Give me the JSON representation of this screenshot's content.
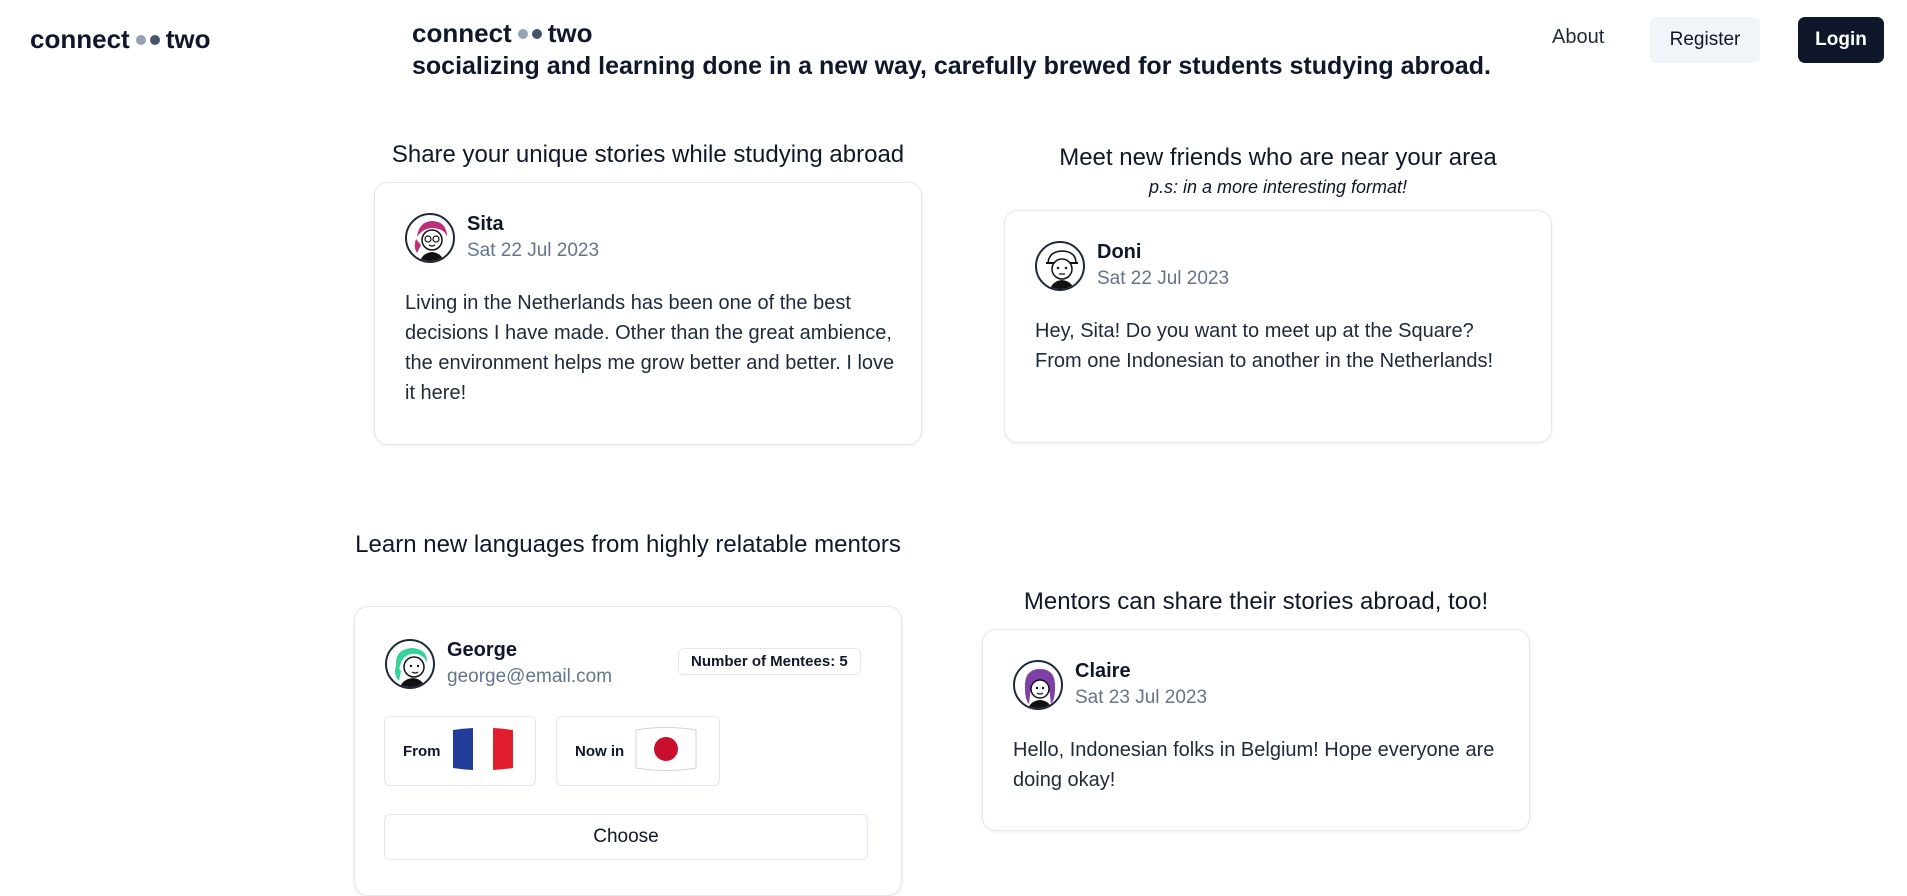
{
  "brand": {
    "word1": "connect",
    "word2": "two",
    "dot1_color": "#94a3b8",
    "dot2_color": "#475569"
  },
  "nav": {
    "about": "About",
    "register": "Register",
    "login": "Login"
  },
  "hero": {
    "tagline": "socializing and learning done in a new way, carefully brewed for students studying abroad."
  },
  "sections": {
    "stories": {
      "title": "Share your unique stories while studying abroad",
      "post": {
        "name": "Sita",
        "date": "Sat 22 Jul 2023",
        "body": "Living in the Netherlands has been one of the best decisions I have made. Other than the great ambience, the environment helps me grow better and better. I love it here!"
      }
    },
    "friends": {
      "title": "Meet new friends who are near your area",
      "subtitle": "p.s: in a more interesting format!",
      "post": {
        "name": "Doni",
        "date": "Sat 22 Jul 2023",
        "body": "Hey, Sita! Do you want to meet up at the Square? From one Indonesian to another in the Netherlands!"
      }
    },
    "languages": {
      "title": "Learn new languages from highly relatable mentors",
      "mentor": {
        "name": "George",
        "email": "george@email.com",
        "mentees_badge": "Number of Mentees: 5",
        "from_label": "From",
        "from_flag": "france-flag",
        "now_label": "Now in",
        "now_flag": "japan-flag",
        "choose": "Choose"
      }
    },
    "mentors": {
      "title": "Mentors can share their stories abroad, too!",
      "post": {
        "name": "Claire",
        "date": "Sat 23 Jul 2023",
        "body": "Hello, Indonesian folks in Belgium! Hope everyone are doing okay!"
      }
    }
  },
  "colors": {
    "primary": "#0f172a",
    "muted": "#64748b",
    "border": "#e2e8f0",
    "secondary_bg": "#f1f5f9"
  }
}
